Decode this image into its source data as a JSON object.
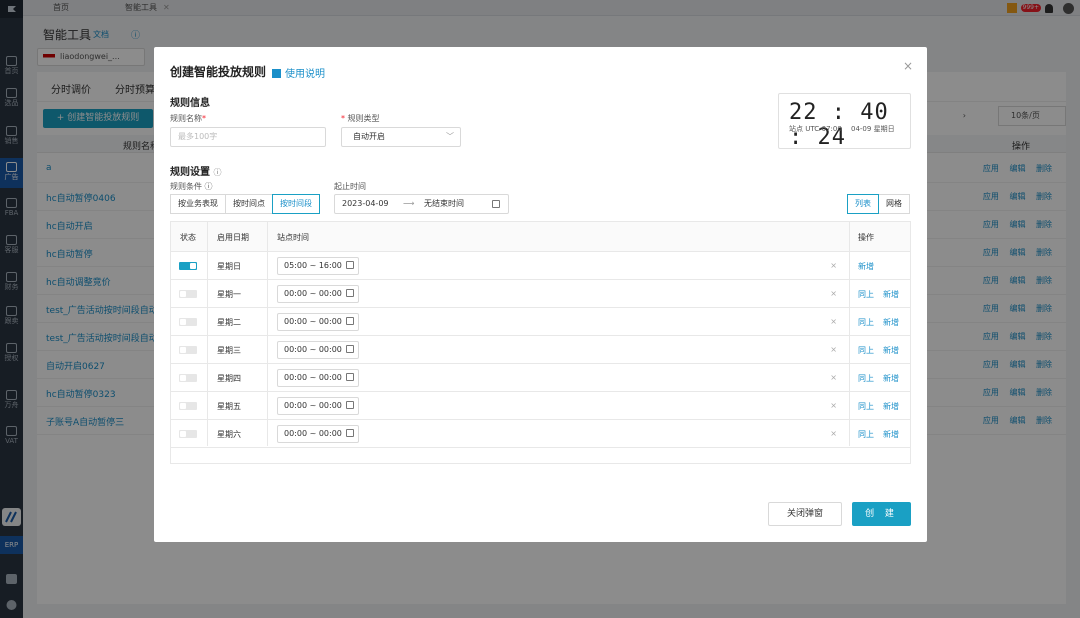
{
  "topbar": {
    "tab_home": "首页",
    "tab_tool": "智能工具",
    "tab_close": "✕",
    "badge": "999+"
  },
  "sidebar": {
    "items": [
      "首页",
      "选品",
      "销售",
      "广告",
      "FBA",
      "客服",
      "财务",
      "跟卖",
      "授权",
      "万舟",
      "VAT"
    ],
    "erp": "ERP"
  },
  "background": {
    "page_title": "智能工具",
    "doc_link": "文档",
    "info_icon": "ⓘ",
    "account": "liaodongwei_...",
    "tabs": [
      "分时调价",
      "分时预算"
    ],
    "create_button": "+ 创建智能投放规则",
    "col_rule_name": "规则名称",
    "col_ops": "操作",
    "pager_page": "页",
    "pager_size": "10条/页",
    "rows": [
      "a",
      "hc自动暂停0406",
      "hc自动开启",
      "hc自动暂停",
      "hc自动调整竞价",
      "test_广告活动按时间段自动",
      "test_广告活动按时间段自动",
      "自动开启0627",
      "hc自动暂停0323",
      "子账号A自动暂停三"
    ],
    "ops": [
      "应用",
      "编辑",
      "删除"
    ]
  },
  "modal": {
    "title": "创建智能投放规则",
    "help": "使用说明",
    "close": "×",
    "section_info": "规则信息",
    "rule_name_label": "规则名称",
    "rule_name_placeholder": "最多100字",
    "rule_type_label": "规则类型",
    "rule_type_value": "自动开启",
    "clock": {
      "time": "22 : 40 : 24",
      "tz": "站点 UTC-07:00",
      "date": "04-09 星期日"
    },
    "section_settings": "规则设置",
    "condition_label": "规则条件",
    "period_label": "起止时间",
    "conditions": [
      "按业务表现",
      "按时间点",
      "按时间段"
    ],
    "start_date": "2023-04-09",
    "arrow": "⟶",
    "end_date": "无结束时间",
    "view_list": "列表",
    "view_grid": "网格",
    "table": {
      "headers": [
        "状态",
        "启用日期",
        "站点时间",
        "操作"
      ],
      "rows": [
        {
          "day": "星期日",
          "time": "05:00 ~ 16:00",
          "on": true,
          "same": "",
          "add": "新增"
        },
        {
          "day": "星期一",
          "time": "00:00 ~ 00:00",
          "on": false,
          "same": "同上",
          "add": "新增"
        },
        {
          "day": "星期二",
          "time": "00:00 ~ 00:00",
          "on": false,
          "same": "同上",
          "add": "新增"
        },
        {
          "day": "星期三",
          "time": "00:00 ~ 00:00",
          "on": false,
          "same": "同上",
          "add": "新增"
        },
        {
          "day": "星期四",
          "time": "00:00 ~ 00:00",
          "on": false,
          "same": "同上",
          "add": "新增"
        },
        {
          "day": "星期五",
          "time": "00:00 ~ 00:00",
          "on": false,
          "same": "同上",
          "add": "新增"
        },
        {
          "day": "星期六",
          "time": "00:00 ~ 00:00",
          "on": false,
          "same": "同上",
          "add": "新增"
        }
      ]
    },
    "btn_close": "关闭弹窗",
    "btn_create": "创 建"
  },
  "colors": {
    "accent": "#1aa0c4",
    "sidebar": "#2b3643",
    "link": "#1a8fc9"
  }
}
